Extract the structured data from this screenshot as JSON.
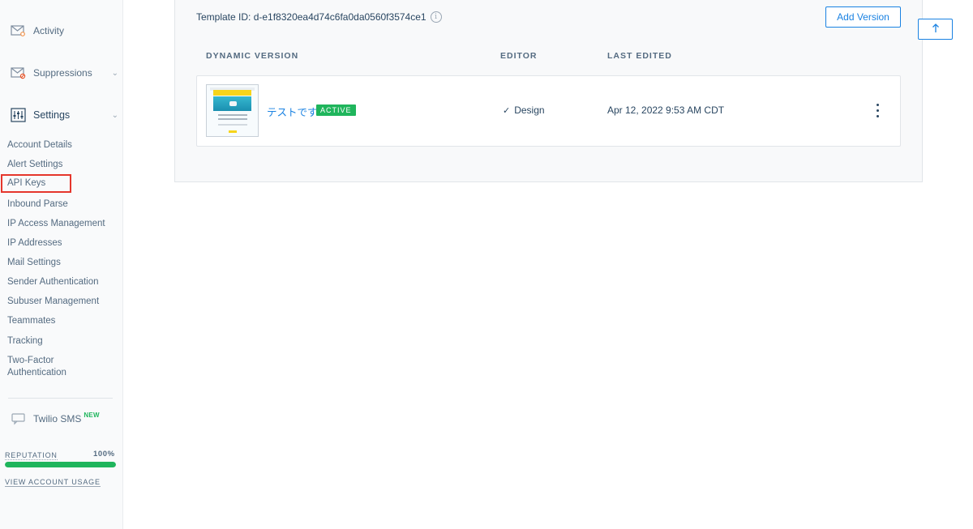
{
  "sidebar": {
    "nav": [
      {
        "label": "Activity",
        "icon": "envelope-search-icon"
      },
      {
        "label": "Suppressions",
        "icon": "envelope-block-icon"
      },
      {
        "label": "Settings",
        "icon": "sliders-icon"
      }
    ],
    "settings_items": [
      "Account Details",
      "Alert Settings",
      "API Keys",
      "Inbound Parse",
      "IP Access Management",
      "IP Addresses",
      "Mail Settings",
      "Sender Authentication",
      "Subuser Management",
      "Teammates",
      "Tracking",
      "Two-Factor",
      "Authentication"
    ],
    "highlighted_item": "API Keys",
    "twilio": {
      "label": "Twilio SMS",
      "badge": "NEW",
      "icon": "chat-bubble-icon"
    },
    "reputation": {
      "label": "REPUTATION",
      "value": "100%",
      "fraction": 1.0,
      "color": "#1fb55c"
    },
    "usage_link": "VIEW ACCOUNT USAGE"
  },
  "main": {
    "template_id": "Template ID: d-e1f8320ea4d74c6fa0da0560f3574ce1",
    "add_version": "Add Version",
    "scroll_top_icon": "arrow-up-icon",
    "columns": {
      "version": "DYNAMIC VERSION",
      "editor": "EDITOR",
      "edited": "LAST EDITED"
    },
    "row": {
      "name": "テストです",
      "status": "ACTIVE",
      "editor": "Design",
      "last_edited": "Apr 12, 2022 9:53 AM CDT"
    }
  },
  "colors": {
    "accent": "#1a82e2",
    "success": "#1fb55c",
    "highlight_border": "#e5362c"
  }
}
